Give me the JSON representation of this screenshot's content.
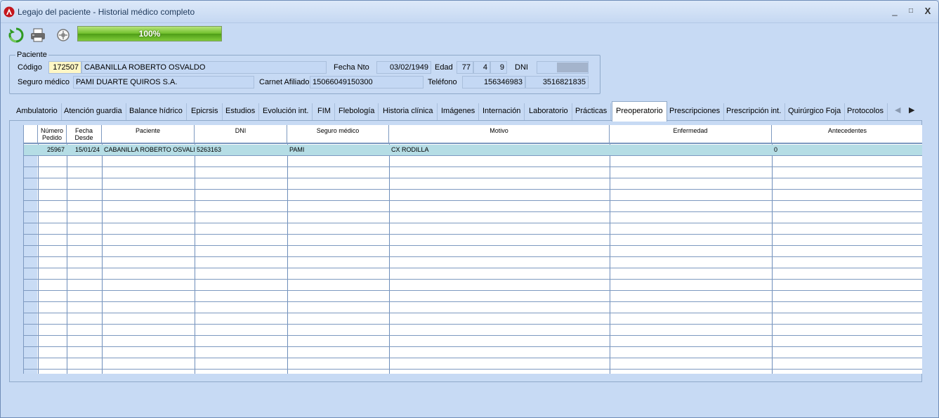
{
  "window": {
    "title": "Legajo del paciente - Historial médico completo",
    "minimize": "_",
    "maximize": "□",
    "close": "X"
  },
  "toolbar": {
    "progress": "100%",
    "progress_value": 100,
    "icons": [
      "refresh-icon",
      "print-icon",
      "settings-icon"
    ]
  },
  "patient": {
    "legend": "Paciente",
    "codigo_label": "Código",
    "codigo": "172507",
    "nombre": "CABANILLA ROBERTO OSVALDO",
    "fecha_nto_label": "Fecha Nto",
    "fecha_nto": "03/02/1949",
    "edad_label": "Edad",
    "edad_years": "77",
    "edad_months": "4",
    "edad_days": "9",
    "dni_label": "DNI",
    "dni": "",
    "seguro_label": "Seguro médico",
    "seguro": "PAMI DUARTE QUIROS S.A.",
    "carnet_label": "Carnet Afiliado",
    "carnet": "15066049150300",
    "telefono_label": "Teléfono",
    "telefono1": "156346983",
    "telefono2": "3516821835"
  },
  "tabs": [
    "Ambulatorio",
    "Atención guardia",
    "Balance hídrico",
    "Epicrsis",
    "Estudios",
    "Evolución int.",
    "FIM",
    "Flebología",
    "Historia clínica",
    "Imágenes",
    "Internación",
    "Laboratorio",
    "Prácticas",
    "Preoperatorio",
    "Prescripciones",
    "Prescripción int.",
    "Quirúrgico Foja",
    "Protocolos"
  ],
  "active_tab": "Preoperatorio",
  "grid": {
    "headers": [
      {
        "l1": "Número",
        "l2": "Pedido"
      },
      {
        "l1": "Fecha",
        "l2": "Desde"
      },
      {
        "l1": "Paciente",
        "l2": ""
      },
      {
        "l1": "DNI",
        "l2": ""
      },
      {
        "l1": "Seguro médico",
        "l2": ""
      },
      {
        "l1": "Motivo",
        "l2": ""
      },
      {
        "l1": "Enfermedad",
        "l2": ""
      },
      {
        "l1": "Antecedentes",
        "l2": ""
      }
    ],
    "rows": [
      {
        "numero": "25967",
        "fecha": "15/01/24",
        "paciente": "CABANILLA ROBERTO OSVALDO",
        "dni": "5263163",
        "seguro": "PAMI",
        "motivo": "CX RODILLA",
        "enfermedad": "",
        "antecedentes": "0"
      }
    ]
  },
  "colors": {
    "window_bg": "#c7daf4",
    "selected_row": "#b5dde5",
    "progress_green": "#6fbf2a"
  }
}
